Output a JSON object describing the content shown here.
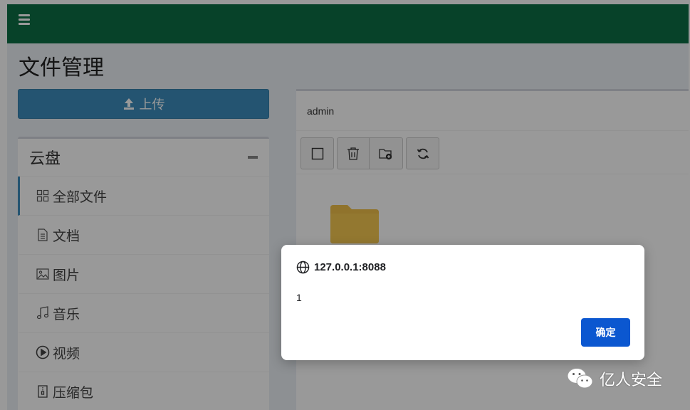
{
  "header": {
    "menu_icon": "hamburger-icon",
    "color": "#0d6f45"
  },
  "page": {
    "title": "文件管理"
  },
  "upload": {
    "label": "上传",
    "icon": "upload-icon",
    "color": "#3c8dbc"
  },
  "sidebar": {
    "title": "云盘",
    "collapse_icon": "minus-icon",
    "items": [
      {
        "label": "全部文件",
        "icon": "grid-icon"
      },
      {
        "label": "文档",
        "icon": "document-icon"
      },
      {
        "label": "图片",
        "icon": "image-icon"
      },
      {
        "label": "音乐",
        "icon": "music-icon"
      },
      {
        "label": "视频",
        "icon": "play-circle-icon"
      },
      {
        "label": "压缩包",
        "icon": "archive-icon"
      }
    ]
  },
  "main": {
    "path": "admin",
    "toolbar": [
      {
        "name": "select-all",
        "icon": "checkbox-icon"
      },
      {
        "name": "delete",
        "icon": "trash-icon"
      },
      {
        "name": "new-folder",
        "icon": "folder-add-icon"
      },
      {
        "name": "refresh",
        "icon": "refresh-icon"
      }
    ],
    "folder_icon": "folder-icon"
  },
  "dialog": {
    "origin": "127.0.0.1:8088",
    "message": "1",
    "ok_label": "确定",
    "icon": "globe-icon",
    "button_color": "#0b57d0"
  },
  "watermark": {
    "text": "亿人安全",
    "icon": "wechat-icon"
  }
}
